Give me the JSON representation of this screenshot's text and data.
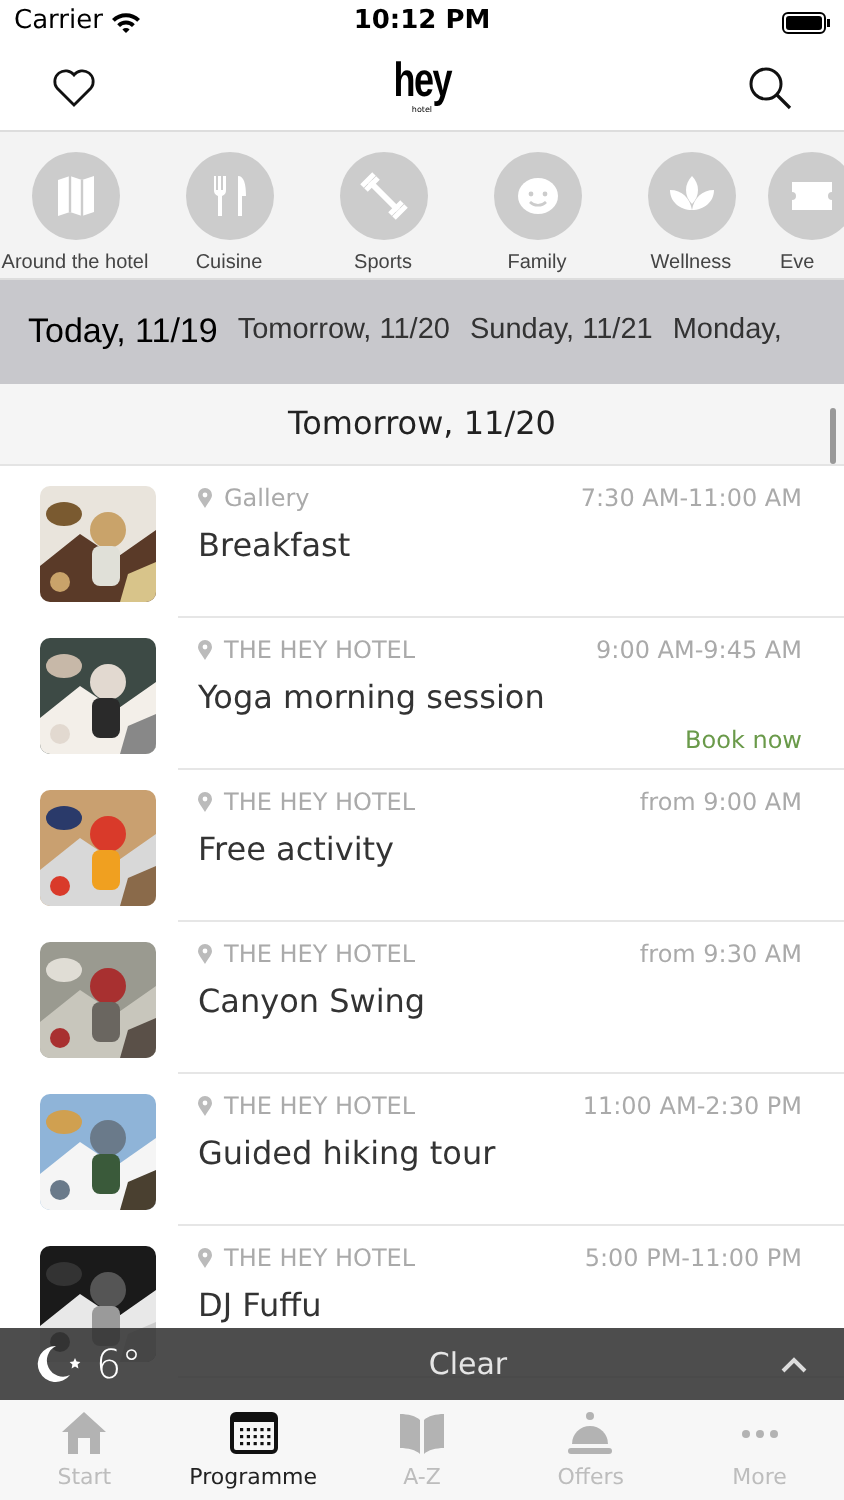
{
  "status_bar": {
    "carrier": "Carrier",
    "time": "10:12 PM"
  },
  "header": {
    "logo": "hey",
    "logo_sub": "hotel"
  },
  "categories": [
    {
      "kind": "map",
      "label": "Around the hotel"
    },
    {
      "kind": "cutlery",
      "label": "Cuisine"
    },
    {
      "kind": "dumbbell",
      "label": "Sports"
    },
    {
      "kind": "face",
      "label": "Family"
    },
    {
      "kind": "lotus",
      "label": "Wellness"
    },
    {
      "kind": "ticket",
      "label": "Eve"
    }
  ],
  "dates": [
    {
      "label": "Today, 11/19",
      "selected": true
    },
    {
      "label": "Tomorrow, 11/20",
      "selected": false
    },
    {
      "label": "Sunday, 11/21",
      "selected": false
    },
    {
      "label": "Monday,",
      "selected": false
    }
  ],
  "section_title": "Tomorrow, 11/20",
  "events": [
    {
      "location": "Gallery",
      "time": "7:30 AM-11:00 AM",
      "title": "Breakfast"
    },
    {
      "location": "THE HEY HOTEL",
      "time": "9:00 AM-9:45 AM",
      "title": "Yoga morning session",
      "action": "Book now"
    },
    {
      "location": "THE HEY HOTEL",
      "time": "from 9:00 AM",
      "title": "Free activity"
    },
    {
      "location": "THE HEY HOTEL",
      "time": "from 9:30 AM",
      "title": "Canyon Swing"
    },
    {
      "location": "THE HEY HOTEL",
      "time": "11:00 AM-2:30 PM",
      "title": "Guided hiking tour"
    },
    {
      "location": "THE HEY HOTEL",
      "time": "5:00 PM-11:00 PM",
      "title": "DJ Fuffu"
    }
  ],
  "weather": {
    "temperature": "6°",
    "condition": "Clear"
  },
  "tabs": [
    {
      "kind": "home",
      "label": "Start",
      "selected": false
    },
    {
      "kind": "calendar",
      "label": "Programme",
      "selected": true
    },
    {
      "kind": "book",
      "label": "A-Z",
      "selected": false
    },
    {
      "kind": "bell",
      "label": "Offers",
      "selected": false
    },
    {
      "kind": "dots",
      "label": "More",
      "selected": false
    }
  ]
}
